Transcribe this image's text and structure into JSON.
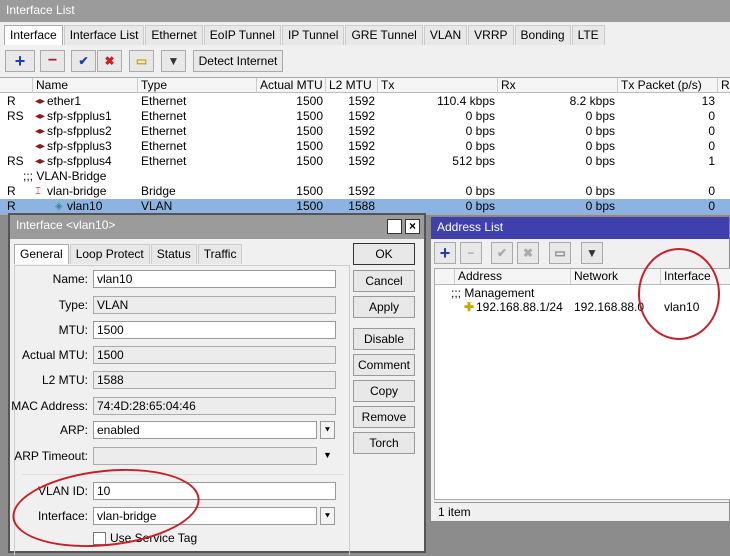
{
  "main_window": {
    "title": "Interface List",
    "tabs": [
      "Interface",
      "Interface List",
      "Ethernet",
      "EoIP Tunnel",
      "IP Tunnel",
      "GRE Tunnel",
      "VLAN",
      "VRRP",
      "Bonding",
      "LTE"
    ],
    "toolbar": {
      "add": "+",
      "remove": "−",
      "enable": "✔",
      "disable": "✖",
      "comment": "▭",
      "filter": "▼",
      "detect": "Detect Internet"
    },
    "columns": [
      "",
      "Name",
      "Type",
      "Actual MTU",
      "L2 MTU",
      "Tx",
      "Rx",
      "Tx Packet (p/s)",
      "Rx"
    ],
    "rows": [
      {
        "flag": "R",
        "name": "ether1",
        "type": "Ethernet",
        "mtu": "1500",
        "l2": "1592",
        "tx": "110.4 kbps",
        "rx": "8.2 kbps",
        "txp": "13",
        "icon": "ethernet-icon"
      },
      {
        "flag": "RS",
        "name": "sfp-sfpplus1",
        "type": "Ethernet",
        "mtu": "1500",
        "l2": "1592",
        "tx": "0 bps",
        "rx": "0 bps",
        "txp": "0",
        "icon": "ethernet-icon"
      },
      {
        "flag": "",
        "name": "sfp-sfpplus2",
        "type": "Ethernet",
        "mtu": "1500",
        "l2": "1592",
        "tx": "0 bps",
        "rx": "0 bps",
        "txp": "0",
        "icon": "ethernet-icon"
      },
      {
        "flag": "",
        "name": "sfp-sfpplus3",
        "type": "Ethernet",
        "mtu": "1500",
        "l2": "1592",
        "tx": "0 bps",
        "rx": "0 bps",
        "txp": "0",
        "icon": "ethernet-icon"
      },
      {
        "flag": "RS",
        "name": "sfp-sfpplus4",
        "type": "Ethernet",
        "mtu": "1500",
        "l2": "1592",
        "tx": "512 bps",
        "rx": "0 bps",
        "txp": "1",
        "icon": "ethernet-icon"
      },
      {
        "comment": ";;; VLAN-Bridge"
      },
      {
        "flag": "R",
        "name": "vlan-bridge",
        "type": "Bridge",
        "mtu": "1500",
        "l2": "1592",
        "tx": "0 bps",
        "rx": "0 bps",
        "txp": "0",
        "icon": "bridge-icon"
      },
      {
        "flag": "R",
        "name": "vlan10",
        "type": "VLAN",
        "mtu": "1500",
        "l2": "1588",
        "tx": "0 bps",
        "rx": "0 bps",
        "txp": "0",
        "icon": "vlan-icon",
        "selected": true
      }
    ]
  },
  "dialog": {
    "title": "Interface <vlan10>",
    "tabs": [
      "General",
      "Loop Protect",
      "Status",
      "Traffic"
    ],
    "fields": {
      "name": {
        "label": "Name:",
        "value": "vlan10"
      },
      "type": {
        "label": "Type:",
        "value": "VLAN"
      },
      "mtu": {
        "label": "MTU:",
        "value": "1500"
      },
      "actual_mtu": {
        "label": "Actual MTU:",
        "value": "1500"
      },
      "l2_mtu": {
        "label": "L2 MTU:",
        "value": "1588"
      },
      "mac": {
        "label": "MAC Address:",
        "value": "74:4D:28:65:04:46"
      },
      "arp": {
        "label": "ARP:",
        "value": "enabled"
      },
      "arp_timeout": {
        "label": "ARP Timeout:",
        "value": ""
      },
      "vlan_id": {
        "label": "VLAN ID:",
        "value": "10"
      },
      "interface": {
        "label": "Interface:",
        "value": "vlan-bridge"
      },
      "service_tag": {
        "label": "Use Service Tag",
        "checked": false
      }
    },
    "buttons": [
      "OK",
      "Cancel",
      "Apply",
      "Disable",
      "Comment",
      "Copy",
      "Remove",
      "Torch"
    ]
  },
  "address_list": {
    "title": "Address List",
    "columns": [
      "Address",
      "Network",
      "Interface"
    ],
    "comment": ";;; Management",
    "rows": [
      {
        "address": "192.168.88.1/24",
        "network": "192.168.88.0",
        "interface": "vlan10"
      }
    ],
    "status": "1 item"
  },
  "colors": {
    "highlight_ellipse": "#c8202a",
    "selection": "#8db3e2",
    "active_title": "#3f3fae"
  }
}
